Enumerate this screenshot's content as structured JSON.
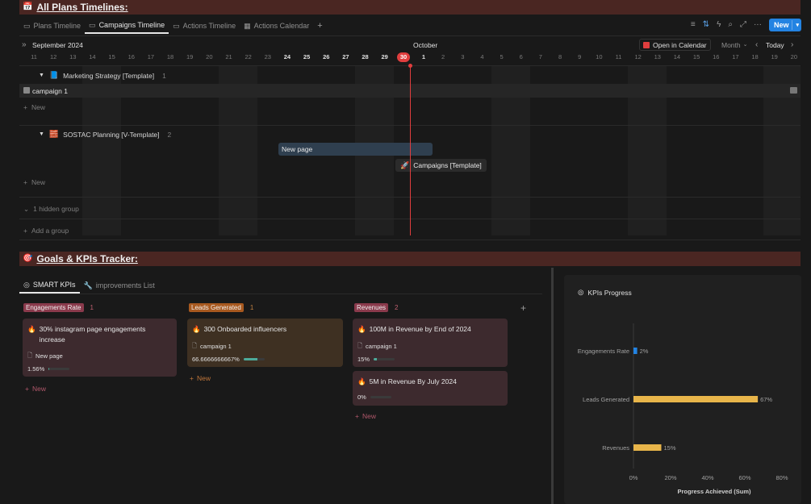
{
  "timelines_section": {
    "title": "All Plans Timelines:",
    "icon": "calendar-icon",
    "tabs": [
      {
        "label": "Plans Timeline",
        "active": false
      },
      {
        "label": "Campaigns Timeline",
        "active": true
      },
      {
        "label": "Actions Timeline",
        "active": false
      },
      {
        "label": "Actions Calendar",
        "active": false
      }
    ],
    "new_button": "New",
    "month_label": "September 2024",
    "next_month_label": "October",
    "open_in_calendar": "Open in Calendar",
    "scale": "Month",
    "today": "Today",
    "days": [
      "11",
      "12",
      "13",
      "14",
      "15",
      "16",
      "17",
      "18",
      "19",
      "20",
      "21",
      "22",
      "23",
      "24",
      "25",
      "26",
      "27",
      "28",
      "29",
      "30",
      "1",
      "2",
      "3",
      "4",
      "5",
      "6",
      "7",
      "8",
      "9",
      "10",
      "11",
      "12",
      "13",
      "14",
      "15",
      "16",
      "17",
      "18",
      "19",
      "20"
    ],
    "bold_days": [
      "24",
      "25",
      "26",
      "27",
      "28",
      "29"
    ],
    "today_day": "30",
    "groups": [
      {
        "name": "Marketing Strategy [Template]",
        "count": "1",
        "item": "campaign 1",
        "new": "New"
      },
      {
        "name": "SOSTAC Planning [V-Template]",
        "count": "2",
        "bar": "New page",
        "item2": "Campaigns [Template]",
        "new": "New"
      }
    ],
    "hidden_group": "1 hidden group",
    "add_group": "Add a group"
  },
  "goals_section": {
    "title": "Goals & KPIs Tracker:",
    "icon": "target-icon",
    "tabs": [
      {
        "label": "SMART KPIs",
        "active": true
      },
      {
        "label": "improvements List",
        "active": false
      }
    ],
    "columns": [
      {
        "name": "Engagements Rate",
        "count": "1",
        "color": "#8a3a4c",
        "bg": "#2a1f22",
        "card_bg": "#3d2a2e",
        "cards": [
          {
            "title": "30% instagram page engagements increase",
            "sub": "New page",
            "pct": "1.56%",
            "progress": 0.0156
          }
        ],
        "new": "New"
      },
      {
        "name": "Leads Generated",
        "count": "1",
        "color": "#a8591f",
        "bg": "#2a231c",
        "card_bg": "#3e3022",
        "cards": [
          {
            "title": "300 Onboarded influencers",
            "sub": "campaign 1",
            "pct": "66.6666666667%",
            "progress": 0.667
          }
        ],
        "new": "New"
      },
      {
        "name": "Revenues",
        "count": "2",
        "color": "#8a3a4c",
        "bg": "#2a1f22",
        "card_bg": "#3d2a2e",
        "cards": [
          {
            "title": "100M in Revenue by End of 2024",
            "sub": "campaign 1",
            "pct": "15%",
            "progress": 0.15
          },
          {
            "title": "5M in Revenue By July 2024",
            "sub": "",
            "pct": "0%",
            "progress": 0
          }
        ],
        "new": "New"
      }
    ]
  },
  "chart_data": {
    "type": "bar",
    "orientation": "horizontal",
    "title": "KPIs Progress",
    "categories": [
      "Engagements Rate",
      "Leads Generated",
      "Revenues"
    ],
    "values": [
      2,
      67,
      15
    ],
    "value_labels": [
      "2%",
      "67%",
      "15%"
    ],
    "colors": [
      "#2383e2",
      "#e8b54a",
      "#e8b54a"
    ],
    "xlabel": "Progress Achieved (Sum)",
    "xticks": [
      "0%",
      "20%",
      "40%",
      "60%",
      "80%"
    ],
    "xlim": [
      0,
      80
    ],
    "grid": false
  }
}
